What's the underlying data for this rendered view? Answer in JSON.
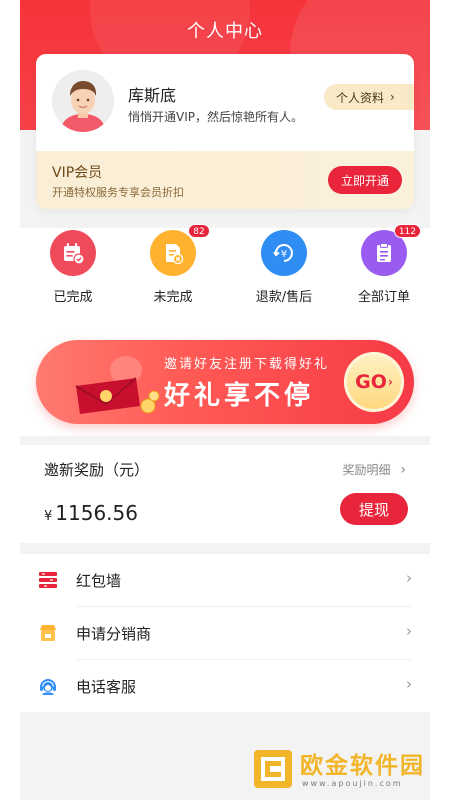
{
  "header": {
    "title": "个人中心"
  },
  "profile": {
    "username": "库斯底",
    "subtitle": "悄悄开通VIP，然后惊艳所有人。",
    "profile_button": "个人资料",
    "chevron": "›"
  },
  "vip": {
    "title": "VIP会员",
    "subtitle": "开通特权服务专享会员折扣",
    "button": "立即开通"
  },
  "orders": [
    {
      "label": "已完成",
      "icon": "calendar-check-icon",
      "color": "#f04b5b",
      "badge": ""
    },
    {
      "label": "未完成",
      "icon": "document-x-icon",
      "color": "#ffb22f",
      "badge": "82"
    },
    {
      "label": "退款/售后",
      "icon": "refund-yuan-icon",
      "color": "#2f8df4",
      "badge": ""
    },
    {
      "label": "全部订单",
      "icon": "clipboard-list-icon",
      "color": "#9a5cf0",
      "badge": "112"
    }
  ],
  "banner": {
    "subtitle": "邀请好友注册下载得好礼",
    "main": "好礼享不停",
    "go": "GO"
  },
  "reward": {
    "title": "邀新奖励（元）",
    "detail": "奖励明细",
    "currency": "¥",
    "amount": "1156.56",
    "button": "提现"
  },
  "menu": [
    {
      "label": "红包墙",
      "icon": "red-envelope-wall-icon"
    },
    {
      "label": "申请分销商",
      "icon": "shop-icon"
    },
    {
      "label": "电话客服",
      "icon": "customer-service-icon"
    }
  ],
  "watermark": {
    "name": "欧金软件园",
    "url": "www.apoujin.com"
  },
  "colors": {
    "primary": "#e8253a",
    "header": "#f5333b",
    "vip_band": "#fbeed6"
  }
}
